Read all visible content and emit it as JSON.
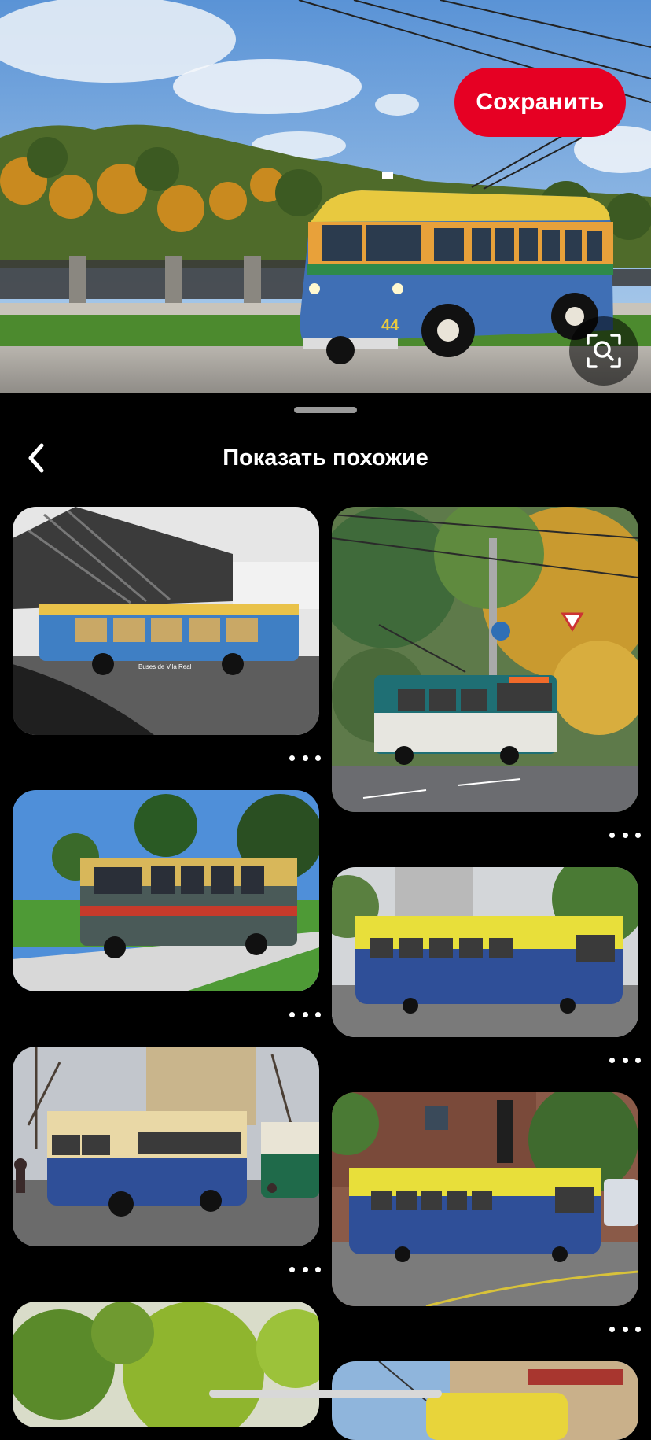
{
  "hero": {
    "save_label": "Сохранить",
    "icons": {
      "lens": "visual-search-icon"
    },
    "colors": {
      "save": "#e60023"
    }
  },
  "sheet": {
    "title": "Показать похожие",
    "icons": {
      "back": "chevron-left-icon",
      "handle": "drag-handle"
    }
  },
  "pins": [
    {
      "caption": "Buses de Vila Real",
      "overlay": "more-options-icon"
    },
    {
      "caption": "",
      "overlay": "more-options-icon"
    },
    {
      "caption": "",
      "overlay": "more-options-icon"
    },
    {
      "caption": "",
      "overlay": "more-options-icon"
    },
    {
      "caption": "",
      "overlay": "more-options-icon"
    },
    {
      "caption": "",
      "overlay": "more-options-icon"
    },
    {
      "caption": "",
      "overlay": "more-options-icon"
    },
    {
      "caption": "",
      "overlay": "more-options-icon"
    }
  ]
}
